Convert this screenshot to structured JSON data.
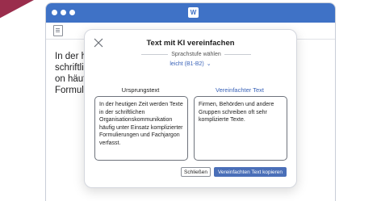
{
  "app": {
    "logo_label": "W"
  },
  "document": {
    "lines": [
      "In der h",
      "schriftli",
      "on häufi",
      "Formuli"
    ]
  },
  "dialog": {
    "title": "Text mit KI vereinfachen",
    "level_label": "Sprachstufe wählen",
    "level_value": "leicht (B1-B2)",
    "source_heading": "Ursprungstext",
    "source_text": "In der heutigen Zeit werden Texte in der schriftlichen Organisationskommunikation häufig unter Einsatz komplizierter Formulierungen und Fachjargon verfasst.",
    "simplified_heading": "Vereinfachter Text",
    "simplified_text": "Firmen, Behörden und andere Gruppen schreiben oft sehr komplizierte Texte.",
    "close_label": "Schließen",
    "copy_label": "Vereinfachten Text kopieren"
  },
  "colors": {
    "titlebar": "#3f72c6",
    "accent": "#3a63b8",
    "primary_button": "#4a6fb8",
    "corner": "#9a2d4c"
  },
  "icons": {
    "close": "close-icon",
    "chevron": "chevron-down-icon",
    "document": "document-icon"
  }
}
